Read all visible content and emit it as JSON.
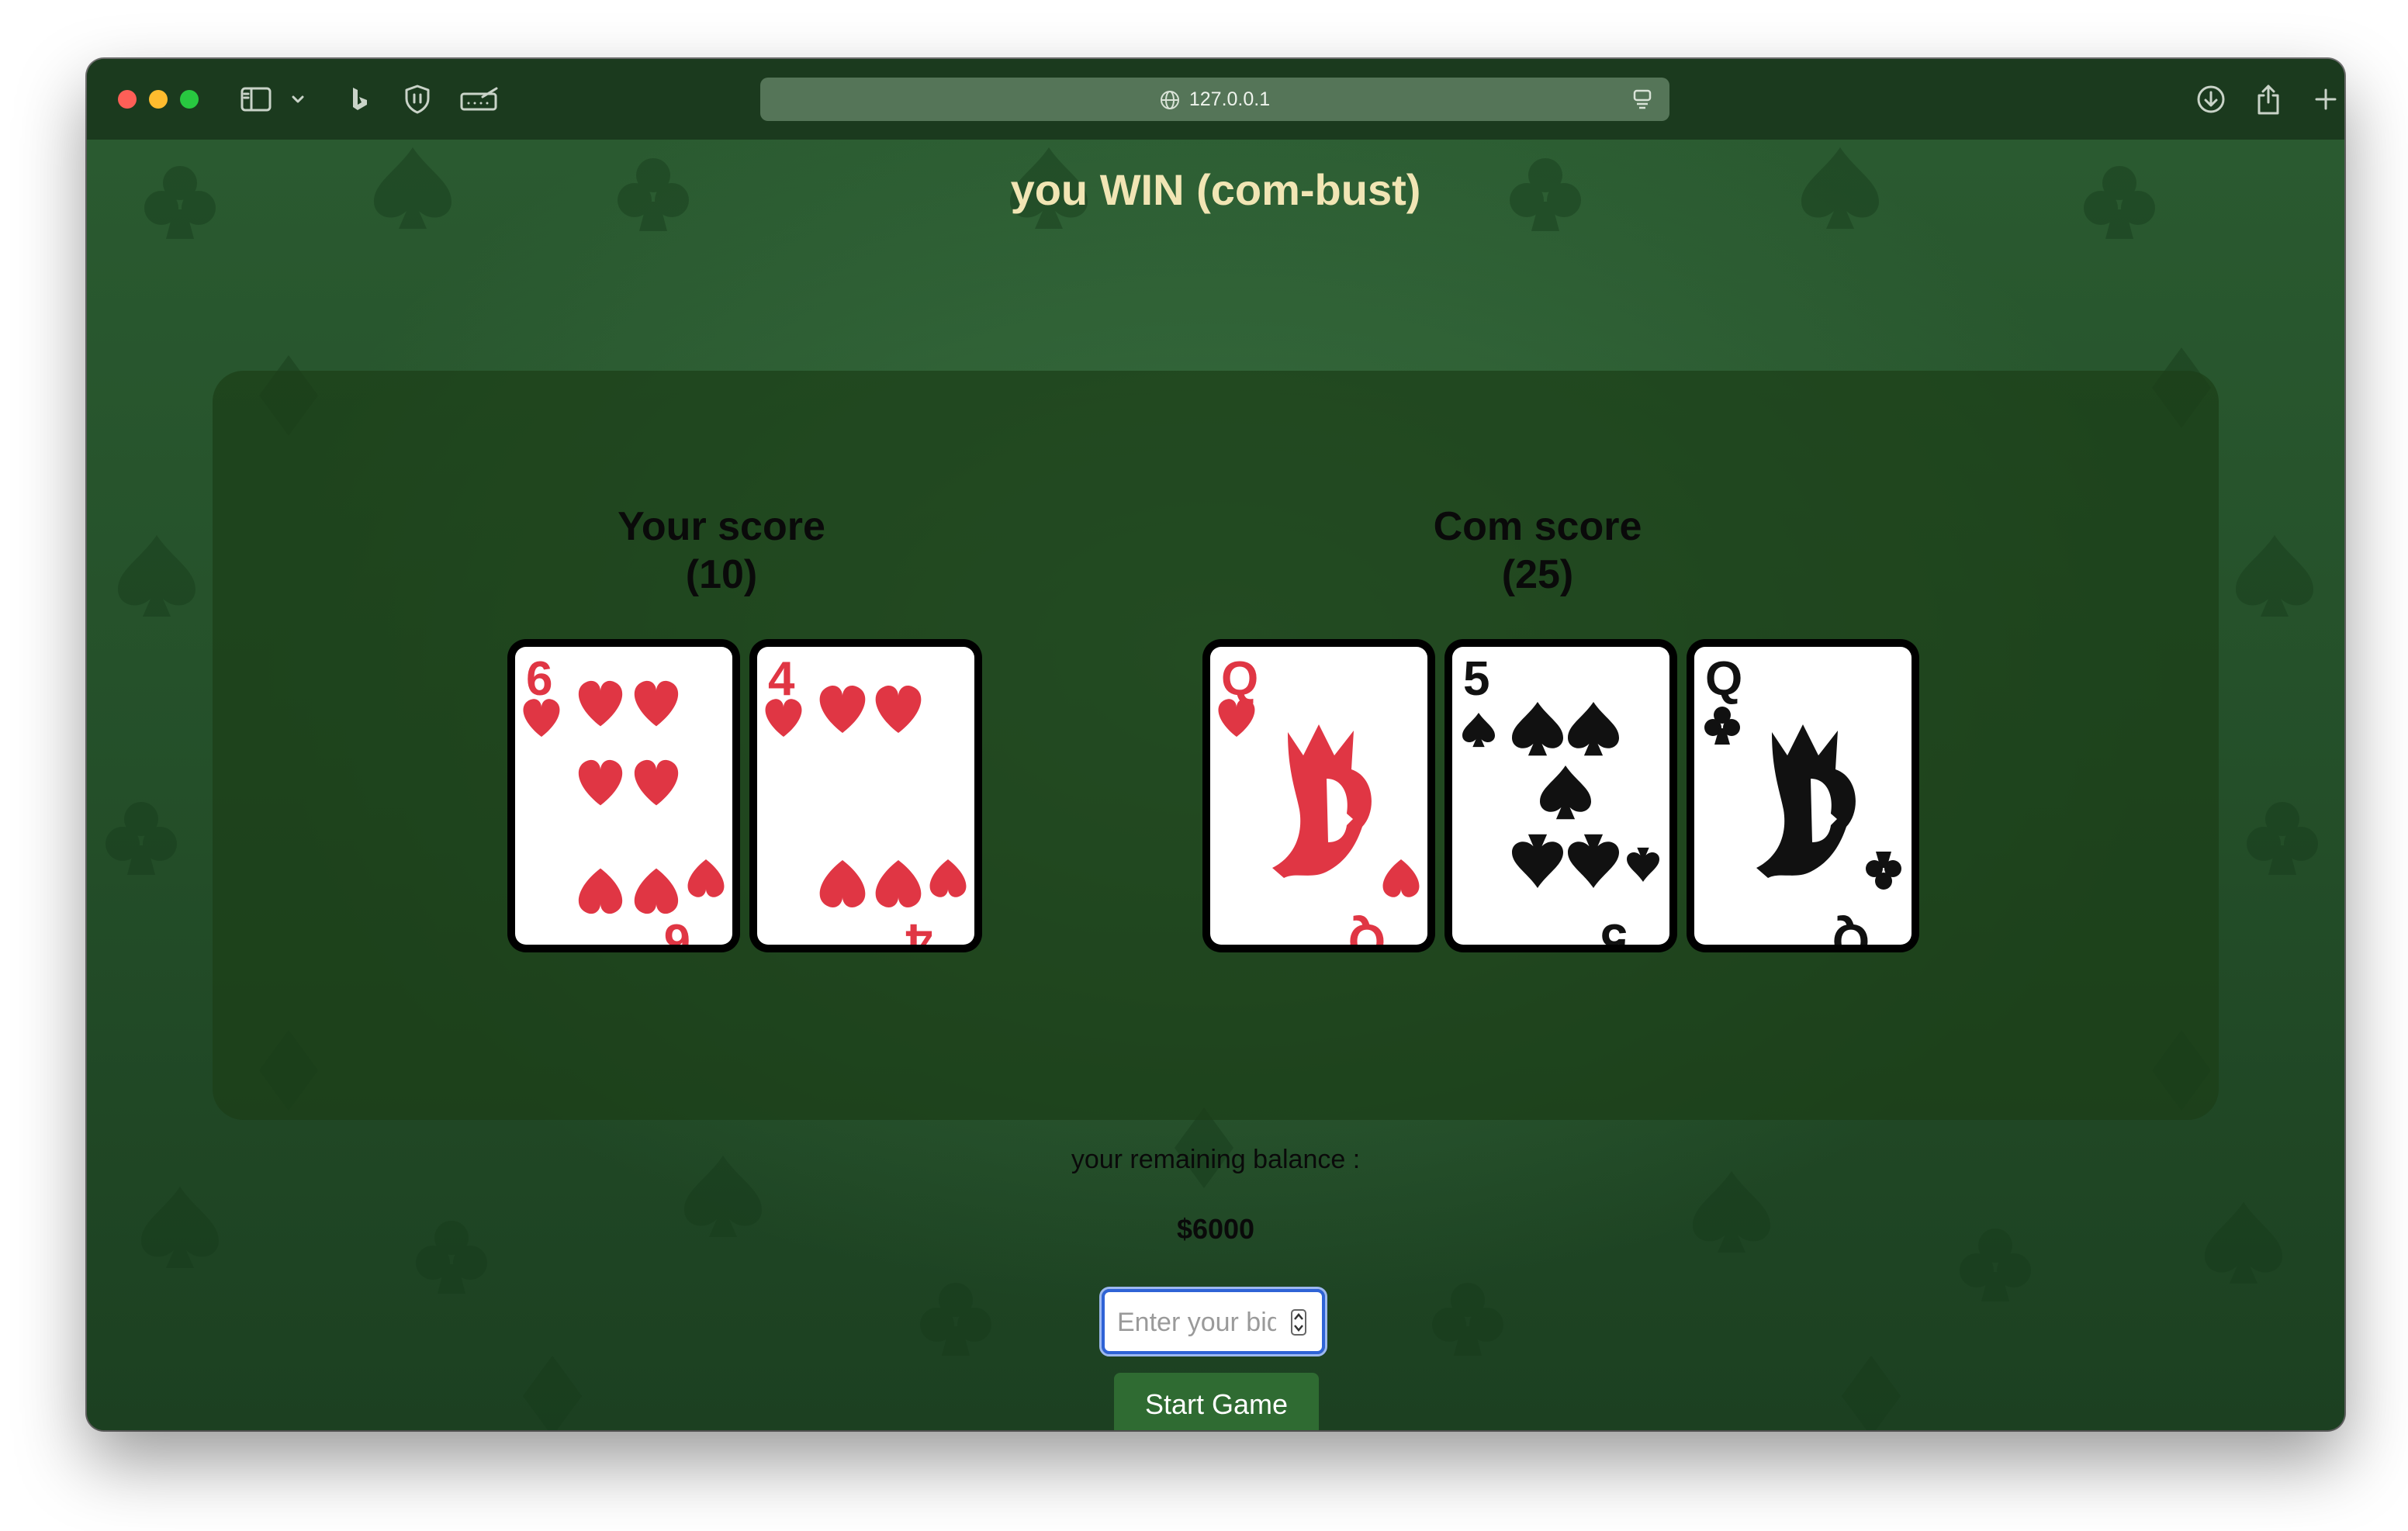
{
  "browser": {
    "url": "127.0.0.1"
  },
  "game": {
    "result_title": "you WIN (com-bust)",
    "player": {
      "label": "Your score",
      "score": "(10)",
      "cards": [
        {
          "rank": "6",
          "suit": "hearts"
        },
        {
          "rank": "4",
          "suit": "hearts"
        }
      ]
    },
    "computer": {
      "label": "Com score",
      "score": "(25)",
      "cards": [
        {
          "rank": "Q",
          "suit": "hearts"
        },
        {
          "rank": "5",
          "suit": "spades"
        },
        {
          "rank": "Q",
          "suit": "clubs"
        }
      ]
    },
    "balance_label": "your remaining balance :",
    "balance_value": "$6000",
    "bid_placeholder": "Enter your bid",
    "start_button": "Start Game"
  },
  "colors": {
    "heart_red": "#e03644",
    "felt_green": "#2a5a30",
    "title_cream": "#f1e5b4",
    "button_green": "#2f6b32"
  },
  "icons": [
    "sidebar-icon",
    "chevron-down-icon",
    "bing-icon",
    "shield-icon",
    "reader-icon",
    "globe-icon",
    "page-menu-icon",
    "download-icon",
    "share-icon",
    "new-tab-icon",
    "tabs-overview-icon"
  ]
}
